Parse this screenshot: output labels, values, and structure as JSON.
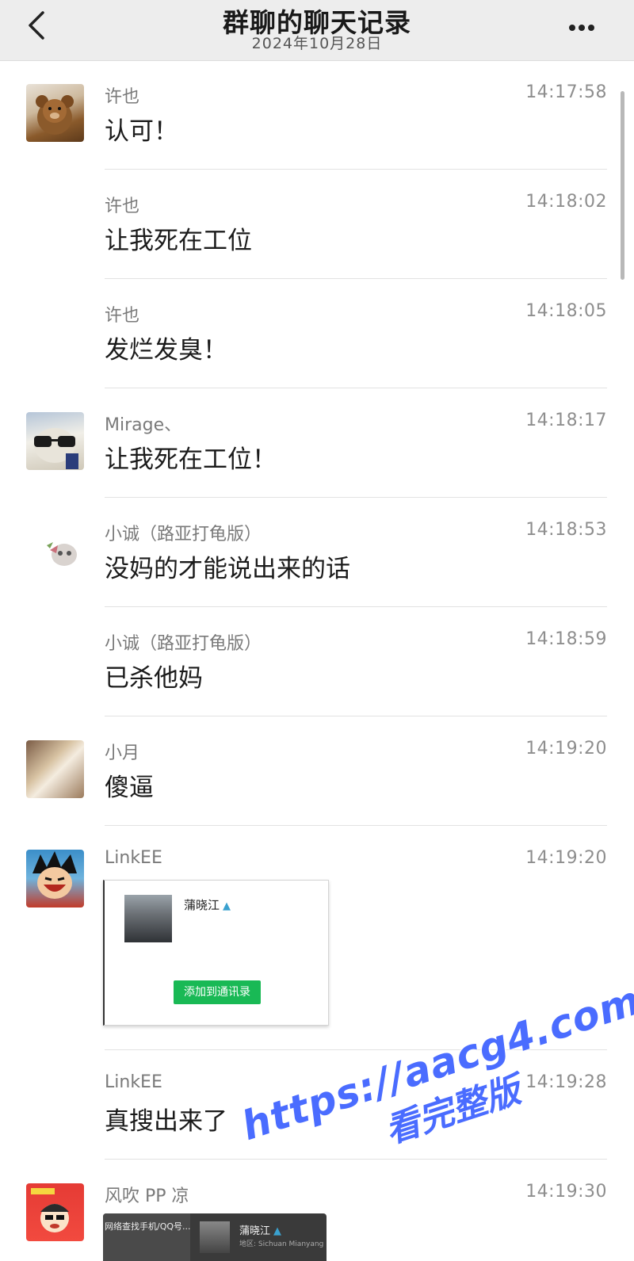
{
  "header": {
    "title": "群聊的聊天记录",
    "date": "2024年10月28日"
  },
  "messages": [
    {
      "sender": "许也",
      "time": "14:17:58",
      "text": "认可！"
    },
    {
      "sender": "许也",
      "time": "14:18:02",
      "text": "让我死在工位"
    },
    {
      "sender": "许也",
      "time": "14:18:05",
      "text": "发烂发臭！"
    },
    {
      "sender": "Mirage、",
      "time": "14:18:17",
      "text": "让我死在工位！"
    },
    {
      "sender": "小诚（路亚打龟版）",
      "time": "14:18:53",
      "text": "没妈的才能说出来的话"
    },
    {
      "sender": "小诚（路亚打龟版）",
      "time": "14:18:59",
      "text": "已杀他妈"
    },
    {
      "sender": "小月",
      "time": "14:19:20",
      "text": "傻逼"
    },
    {
      "sender": "LinkEE",
      "time": "14:19:20",
      "card": {
        "name": "蒲晓江",
        "add_button": "添加到通讯录"
      }
    },
    {
      "sender": "LinkEE",
      "time": "14:19:28",
      "text": "真搜出来了"
    },
    {
      "sender": "风吹 PP 凉",
      "time": "14:19:30",
      "card": {
        "left_text": "网络查找手机/QQ号...",
        "name": "蒲晓江",
        "region": "地区: Sichuan Mianyang"
      }
    }
  ],
  "watermark": {
    "url": "https://aacg4.com",
    "subtitle": "看完整版"
  },
  "colors": {
    "header_bg": "#ededed",
    "add_button": "#19b955",
    "watermark": "#4a6cff"
  }
}
